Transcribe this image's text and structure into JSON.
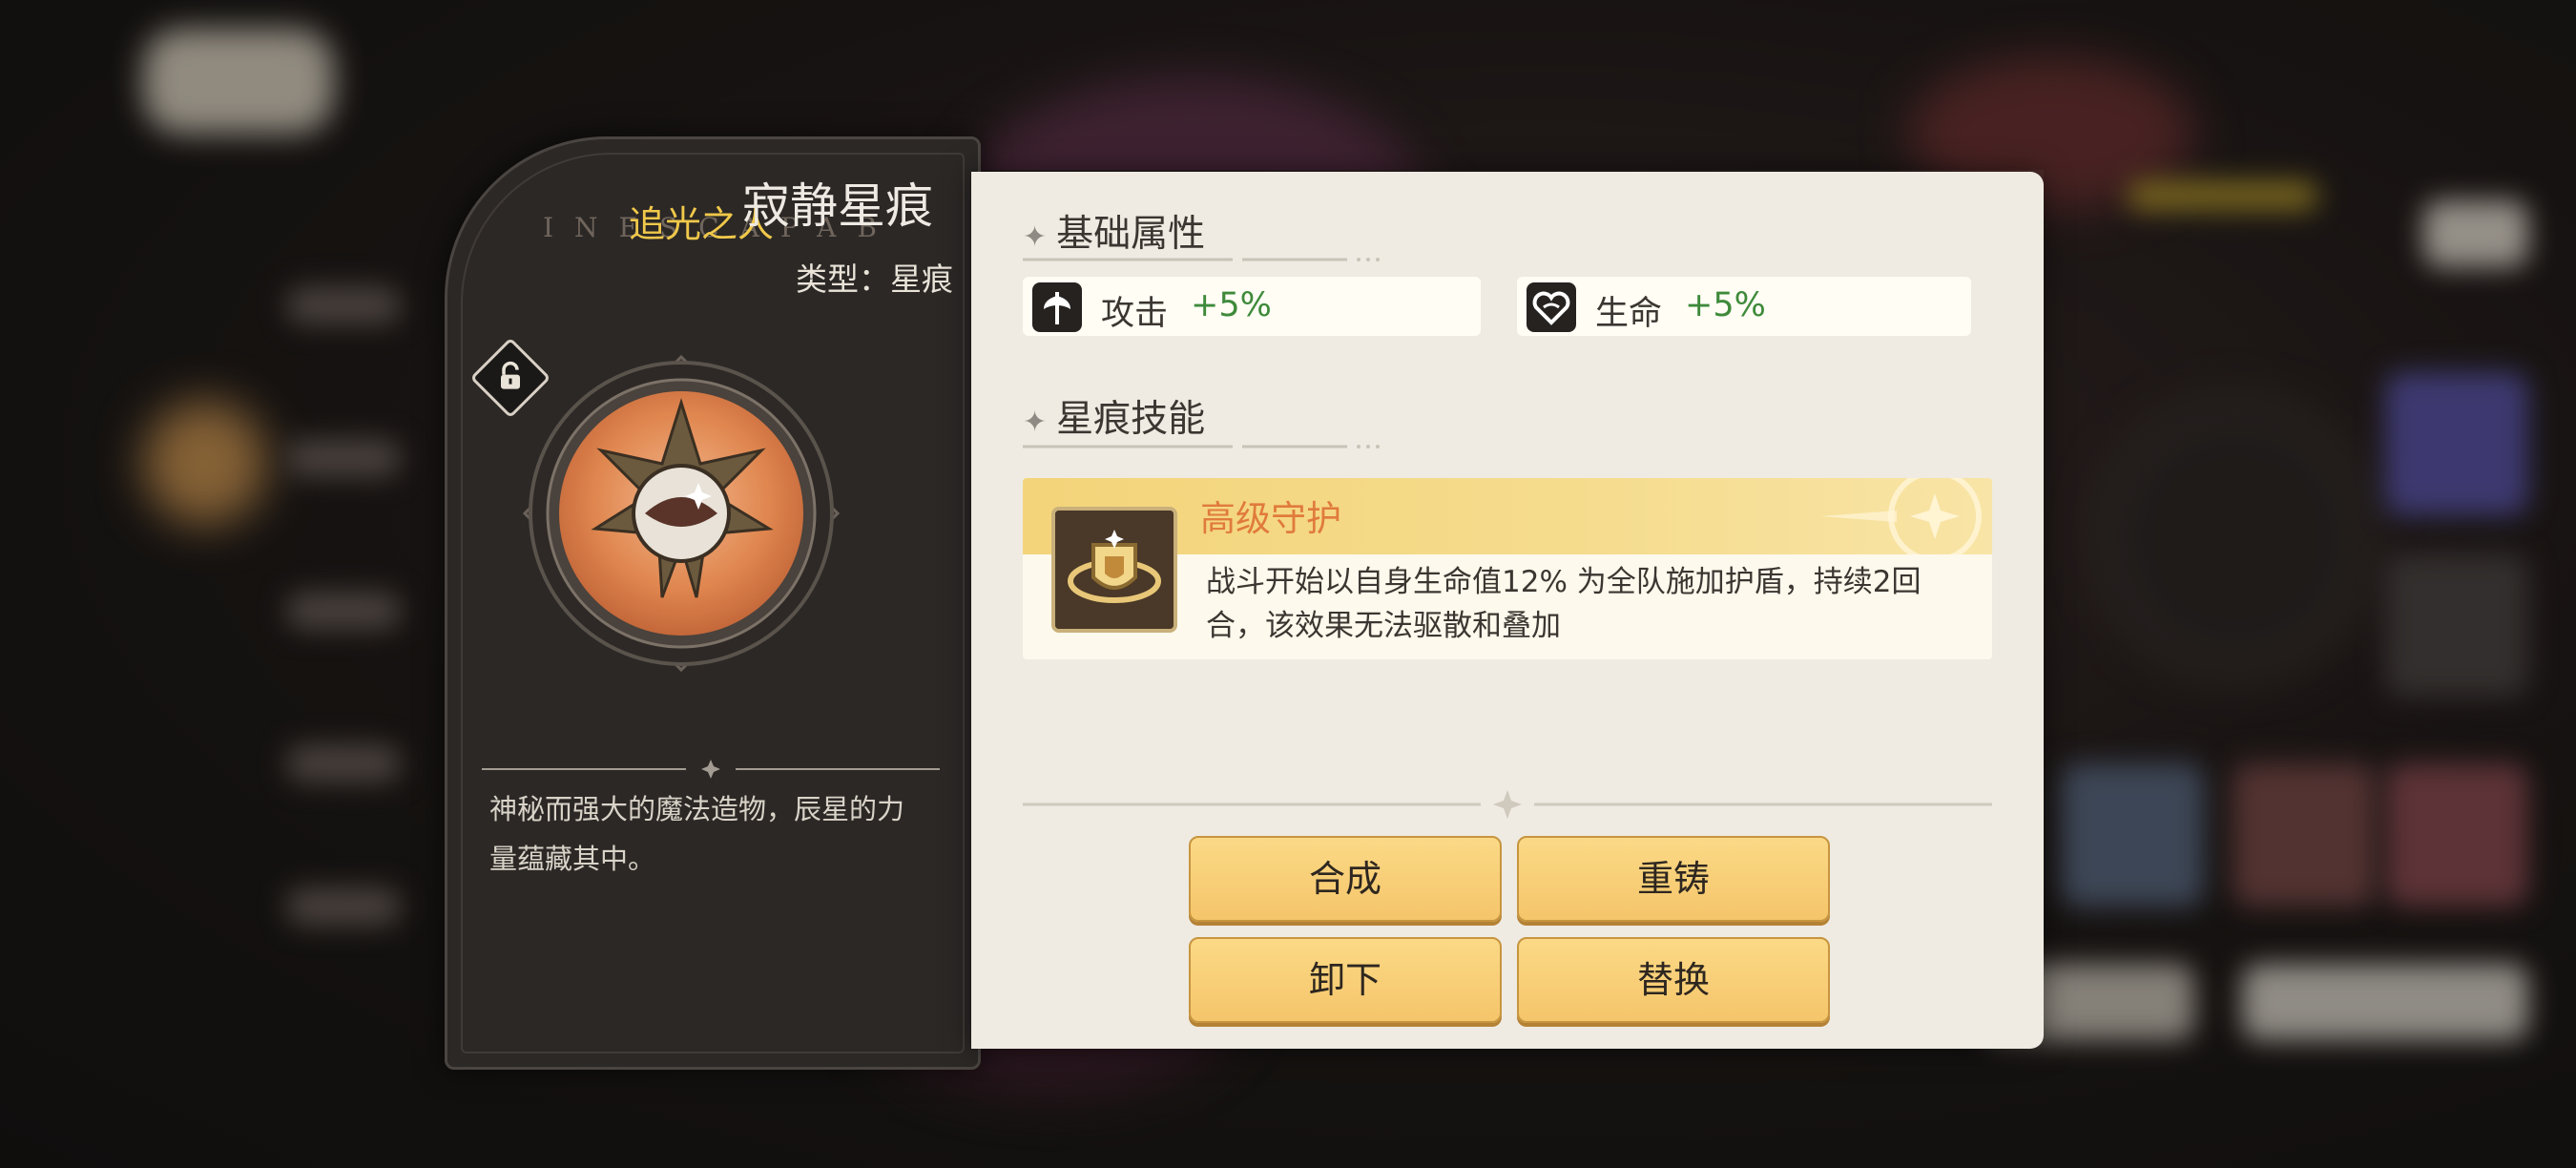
{
  "item": {
    "name": "寂静星痕",
    "subtitle": "追光之人",
    "watermark": "INESCAPAB",
    "type_label": "类型：星痕",
    "description": "神秘而强大的魔法造物，辰星的力量蕴藏其中。"
  },
  "sections": {
    "basic_attributes": "基础属性",
    "skills": "星痕技能"
  },
  "stats": [
    {
      "icon": "axe-icon",
      "label": "攻击",
      "value": "+5%"
    },
    {
      "icon": "heart-icon",
      "label": "生命",
      "value": "+5%"
    }
  ],
  "skill": {
    "icon": "shield-icon",
    "name": "高级守护",
    "description": "战斗开始以自身生命值12% 为全队施加护盾，持续2回合，该效果无法驱散和叠加"
  },
  "buttons": {
    "synthesize": "合成",
    "recast": "重铸",
    "unequip": "卸下",
    "replace": "替换"
  },
  "colors": {
    "accent_gold": "#f5c56a",
    "value_green": "#3e8a3a",
    "skill_name_orange": "#e07b3c",
    "subtitle_yellow": "#f0c84a"
  }
}
